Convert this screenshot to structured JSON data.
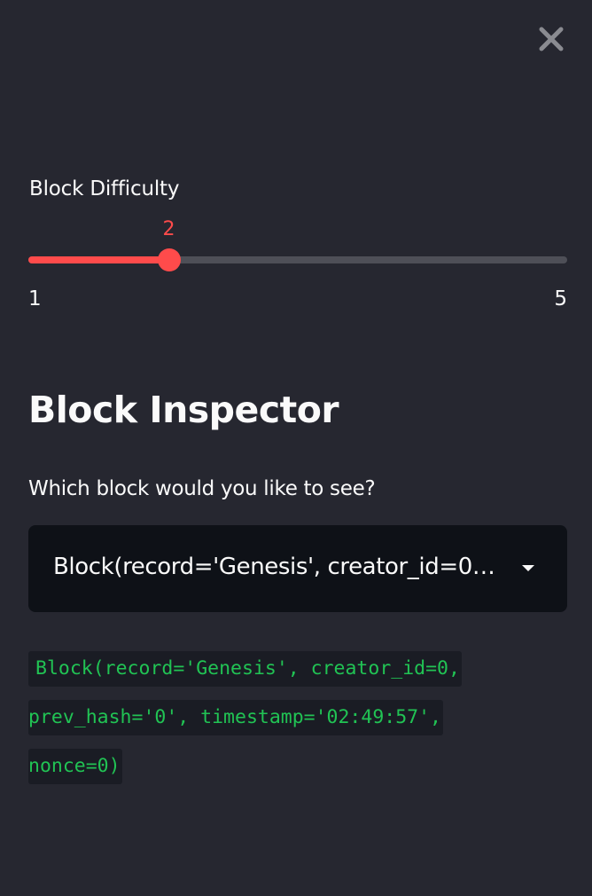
{
  "window": {
    "close_icon": "close-icon"
  },
  "slider": {
    "label": "Block Difficulty",
    "value": 2,
    "min": 1,
    "max": 5,
    "accent_color": "#ff4b4b",
    "track_color": "#4e4f57"
  },
  "inspector": {
    "title": "Block Inspector",
    "select_label": "Which block would you like to see?",
    "selected_option": "Block(record='Genesis', creator_id=0, prev_hash='0', timestamp='02:49:57', nonce=0)",
    "chevron_icon": "chevron-down-icon"
  },
  "code_output": {
    "lines": [
      "Block(record='Genesis', creator_id=0,",
      "prev_hash='0', timestamp='02:49:57',",
      "nonce=0)"
    ],
    "text_color": "#21c354"
  },
  "theme": {
    "sidebar_background": "#262730",
    "select_background": "#0e1117",
    "code_background": "#1a1c24"
  }
}
